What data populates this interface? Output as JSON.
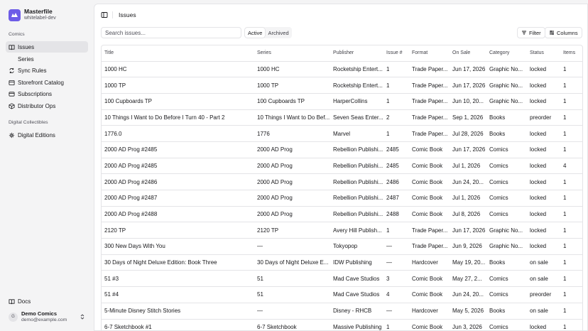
{
  "brand": {
    "name": "Masterfile",
    "env": "whitelabel-dev",
    "color": "#6d5ce7"
  },
  "sidebar": {
    "sections": [
      {
        "label": "Comics"
      },
      {
        "label": "Digital Collectibles"
      }
    ],
    "items": [
      {
        "label": "Issues",
        "icon": "book-icon"
      },
      {
        "label": "Series"
      },
      {
        "label": "Sync Rules",
        "icon": "sync-icon"
      },
      {
        "label": "Storefront Catalog",
        "icon": "catalog-icon"
      },
      {
        "label": "Subscriptions",
        "icon": "subscriptions-icon"
      },
      {
        "label": "Distributor Ops",
        "icon": "ops-icon"
      },
      {
        "label": "Digital Editions",
        "icon": "digital-editions-icon"
      }
    ],
    "docs": "Docs",
    "user": {
      "initial": "G",
      "name": "Demo Comics",
      "email": "demo@example.com"
    }
  },
  "header": {
    "title": "Issues"
  },
  "toolbar": {
    "search_placeholder": "Search issues...",
    "tab_active": "Active",
    "tab_archived": "Archived",
    "filter": "Filter",
    "columns": "Columns"
  },
  "table": {
    "columns": [
      "Title",
      "Series",
      "Publisher",
      "Issue #",
      "Format",
      "On Sale",
      "Category",
      "Status",
      "Items"
    ],
    "rows": [
      [
        "1000 HC",
        "1000 HC",
        "Rocketship Entert...",
        "1",
        "Trade Paper...",
        "Jun 17, 2026",
        "Graphic No...",
        "locked",
        "1"
      ],
      [
        "1000 TP",
        "1000 TP",
        "Rocketship Entert...",
        "1",
        "Trade Paper...",
        "Jun 17, 2026",
        "Graphic No...",
        "locked",
        "1"
      ],
      [
        "100 Cupboards TP",
        "100 Cupboards TP",
        "HarperCollins",
        "1",
        "Trade Paper...",
        "Jun 10, 20...",
        "Graphic No...",
        "locked",
        "1"
      ],
      [
        "10 Things I Want to Do Before I Turn 40 - Part 2",
        "10 Things I Want to Do Bef...",
        "Seven Seas Enter...",
        "2",
        "Trade Paper...",
        "Sep 1, 2026",
        "Books",
        "preorder",
        "1"
      ],
      [
        "1776.0",
        "1776",
        "Marvel",
        "1",
        "Trade Paper...",
        "Jul 28, 2026",
        "Books",
        "locked",
        "1"
      ],
      [
        "2000 AD Prog #2485",
        "2000 AD Prog",
        "Rebellion Publishi...",
        "2485",
        "Comic Book",
        "Jun 17, 2026",
        "Comics",
        "locked",
        "1"
      ],
      [
        "2000 AD Prog #2485",
        "2000 AD Prog",
        "Rebellion Publishi...",
        "2485",
        "Comic Book",
        "Jul 1, 2026",
        "Comics",
        "locked",
        "4"
      ],
      [
        "2000 AD Prog #2486",
        "2000 AD Prog",
        "Rebellion Publishi...",
        "2486",
        "Comic Book",
        "Jun 24, 20...",
        "Comics",
        "locked",
        "1"
      ],
      [
        "2000 AD Prog #2487",
        "2000 AD Prog",
        "Rebellion Publishi...",
        "2487",
        "Comic Book",
        "Jul 1, 2026",
        "Comics",
        "locked",
        "1"
      ],
      [
        "2000 AD Prog #2488",
        "2000 AD Prog",
        "Rebellion Publishi...",
        "2488",
        "Comic Book",
        "Jul 8, 2026",
        "Comics",
        "locked",
        "1"
      ],
      [
        "2120 TP",
        "2120 TP",
        "Avery Hill Publish...",
        "1",
        "Trade Paper...",
        "Jun 17, 2026",
        "Graphic No...",
        "locked",
        "1"
      ],
      [
        "300 New Days With You",
        "—",
        "Tokyopop",
        "—",
        "Trade Paper...",
        "Jun 9, 2026",
        "Graphic No...",
        "locked",
        "1"
      ],
      [
        "30 Days of Night Deluxe Edition: Book Three",
        "30 Days of Night Deluxe E...",
        "IDW Publishing",
        "—",
        "Hardcover",
        "May 19, 20...",
        "Books",
        "on sale",
        "1"
      ],
      [
        "51 #3",
        "51",
        "Mad Cave Studios",
        "3",
        "Comic Book",
        "May 27, 2...",
        "Comics",
        "on sale",
        "1"
      ],
      [
        "51 #4",
        "51",
        "Mad Cave Studios",
        "4",
        "Comic Book",
        "Jun 24, 20...",
        "Comics",
        "preorder",
        "1"
      ],
      [
        "5-Minute Disney Stitch Stories",
        "—",
        "Disney - RHCB",
        "—",
        "Hardcover",
        "May 5, 2026",
        "Books",
        "on sale",
        "1"
      ],
      [
        "6-7 Sketchbook #1",
        "6-7 Sketchbook",
        "Massive Publishing",
        "1",
        "Comic Book",
        "Jun 3, 2026",
        "Comics",
        "locked",
        "1"
      ]
    ]
  }
}
